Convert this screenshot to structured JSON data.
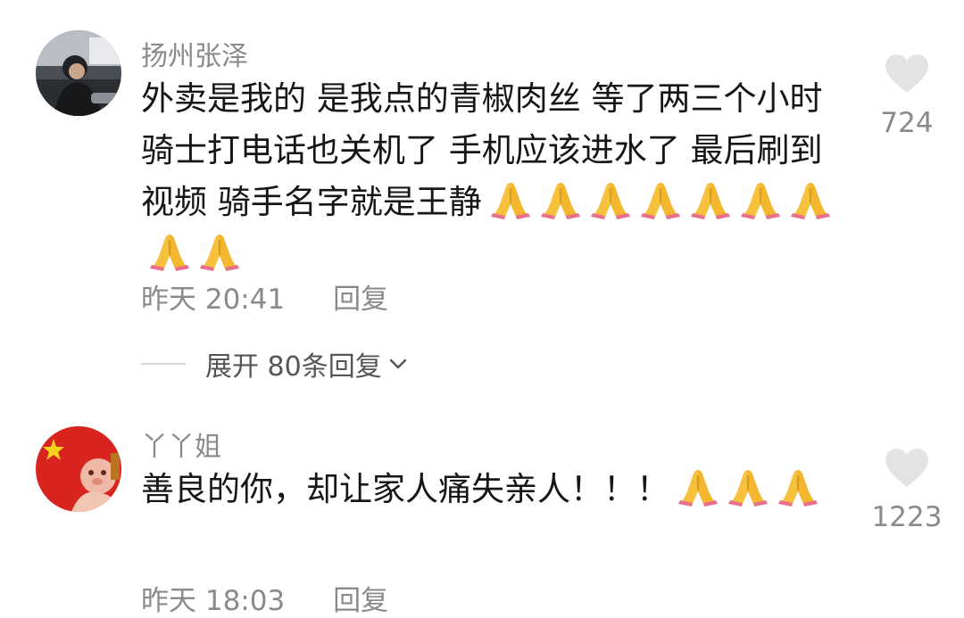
{
  "comments": [
    {
      "author": "扬州张泽",
      "avatar_icon": "avatar-photo",
      "text": "外卖是我的 是我点的青椒肉丝 等了两三个小时 骑士打电话也关机了 手机应该进水了 最后刷到视频 骑手名字就是王静",
      "emoji_count": 9,
      "emoji_icon": "folded-hands-emoji",
      "time": "昨天 20:41",
      "reply_label": "回复",
      "likes": "724"
    },
    {
      "author": "丫丫姐",
      "avatar_icon": "avatar-flag-photo",
      "text": "善良的你，却让家人痛失亲人！！！",
      "emoji_count": 3,
      "emoji_icon": "folded-hands-emoji",
      "time": "昨天 18:03",
      "reply_label": "回复",
      "likes": "1223"
    }
  ],
  "expand_replies": {
    "label": "展开 80条回复",
    "icon": "chevron-down-icon"
  },
  "colors": {
    "meta_text": "#8a8a8a",
    "heart": "#e3e3e3",
    "divider": "#d6d6d6"
  }
}
